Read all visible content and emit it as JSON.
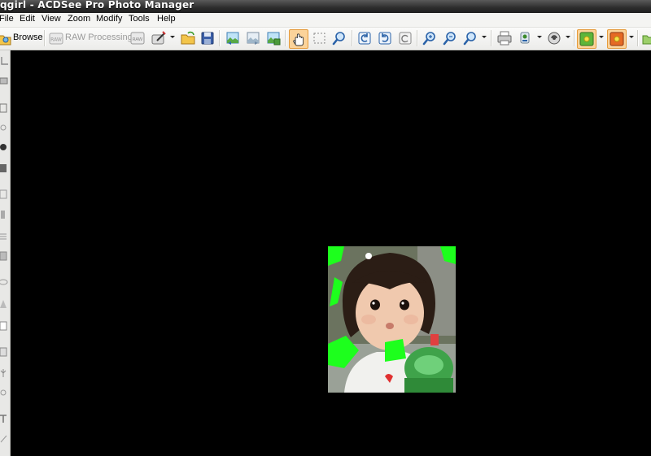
{
  "window": {
    "title": "qgirl - ACDSee Pro Photo Manager"
  },
  "menu": {
    "items": [
      "File",
      "Edit",
      "View",
      "Zoom",
      "Modify",
      "Tools",
      "Help"
    ]
  },
  "toolbar": {
    "browse_label": "Browse",
    "raw_processing_label": "RAW Processing",
    "raw_icon_text": "RAW"
  },
  "colors": {
    "title_bg": "#2c2c2c",
    "toolbar_bg": "#f0f0ee",
    "canvas_bg": "#000000",
    "highlight": "#fbd39a"
  },
  "viewer": {
    "image_name": "qgirl"
  }
}
